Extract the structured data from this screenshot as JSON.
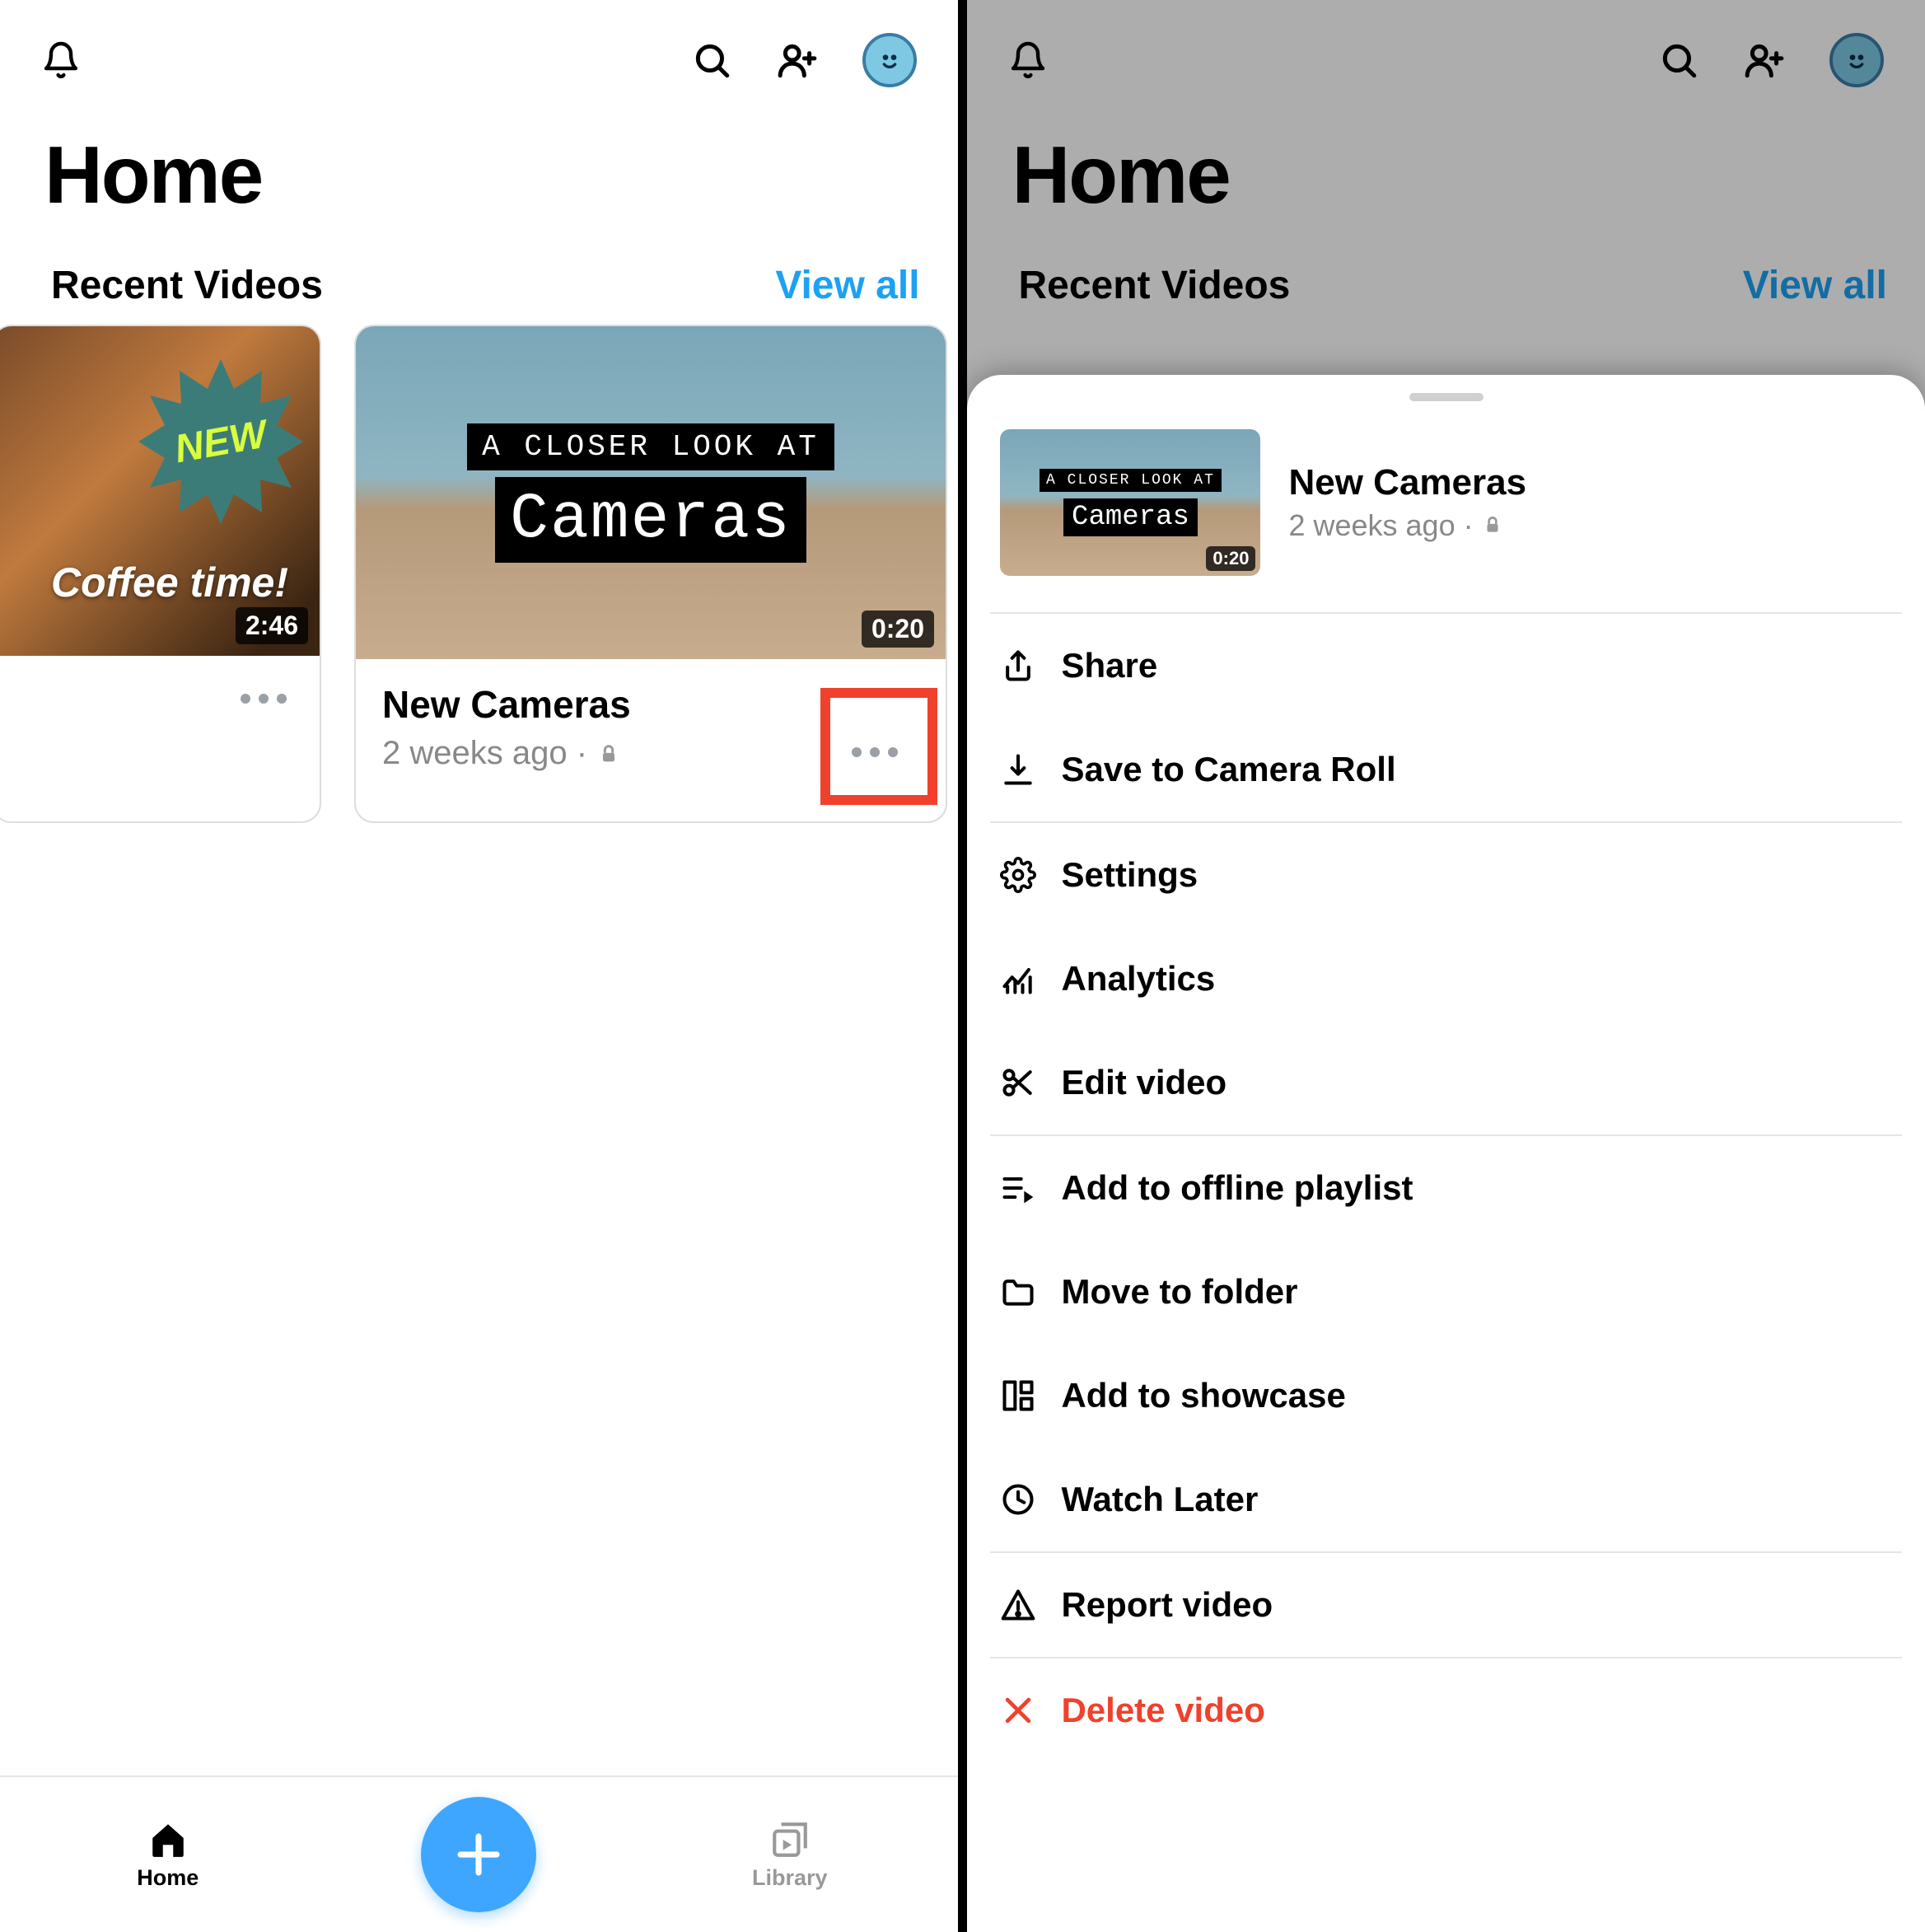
{
  "left": {
    "title": "Home",
    "section": "Recent Videos",
    "viewAll": "View all",
    "card0": {
      "badge": "NEW",
      "overlay": "Coffee time!",
      "duration": "2:46"
    },
    "card1": {
      "overlayTop": "A CLOSER LOOK AT",
      "overlayBig": "Cameras",
      "duration": "0:20",
      "title": "New Cameras",
      "sub": "2 weeks ago ·"
    },
    "tabs": {
      "home": "Home",
      "library": "Library"
    }
  },
  "right": {
    "title": "Home",
    "section": "Recent Videos",
    "viewAll": "View all",
    "sheet": {
      "thumbTop": "A CLOSER LOOK AT",
      "thumbBig": "Cameras",
      "thumbDuration": "0:20",
      "title": "New Cameras",
      "sub": "2 weeks ago ·",
      "items": {
        "share": "Share",
        "save": "Save to Camera Roll",
        "settings": "Settings",
        "analytics": "Analytics",
        "edit": "Edit video",
        "offline": "Add to offline playlist",
        "folder": "Move to folder",
        "showcase": "Add to showcase",
        "watchlater": "Watch Later",
        "report": "Report video",
        "delete": "Delete video"
      }
    }
  }
}
